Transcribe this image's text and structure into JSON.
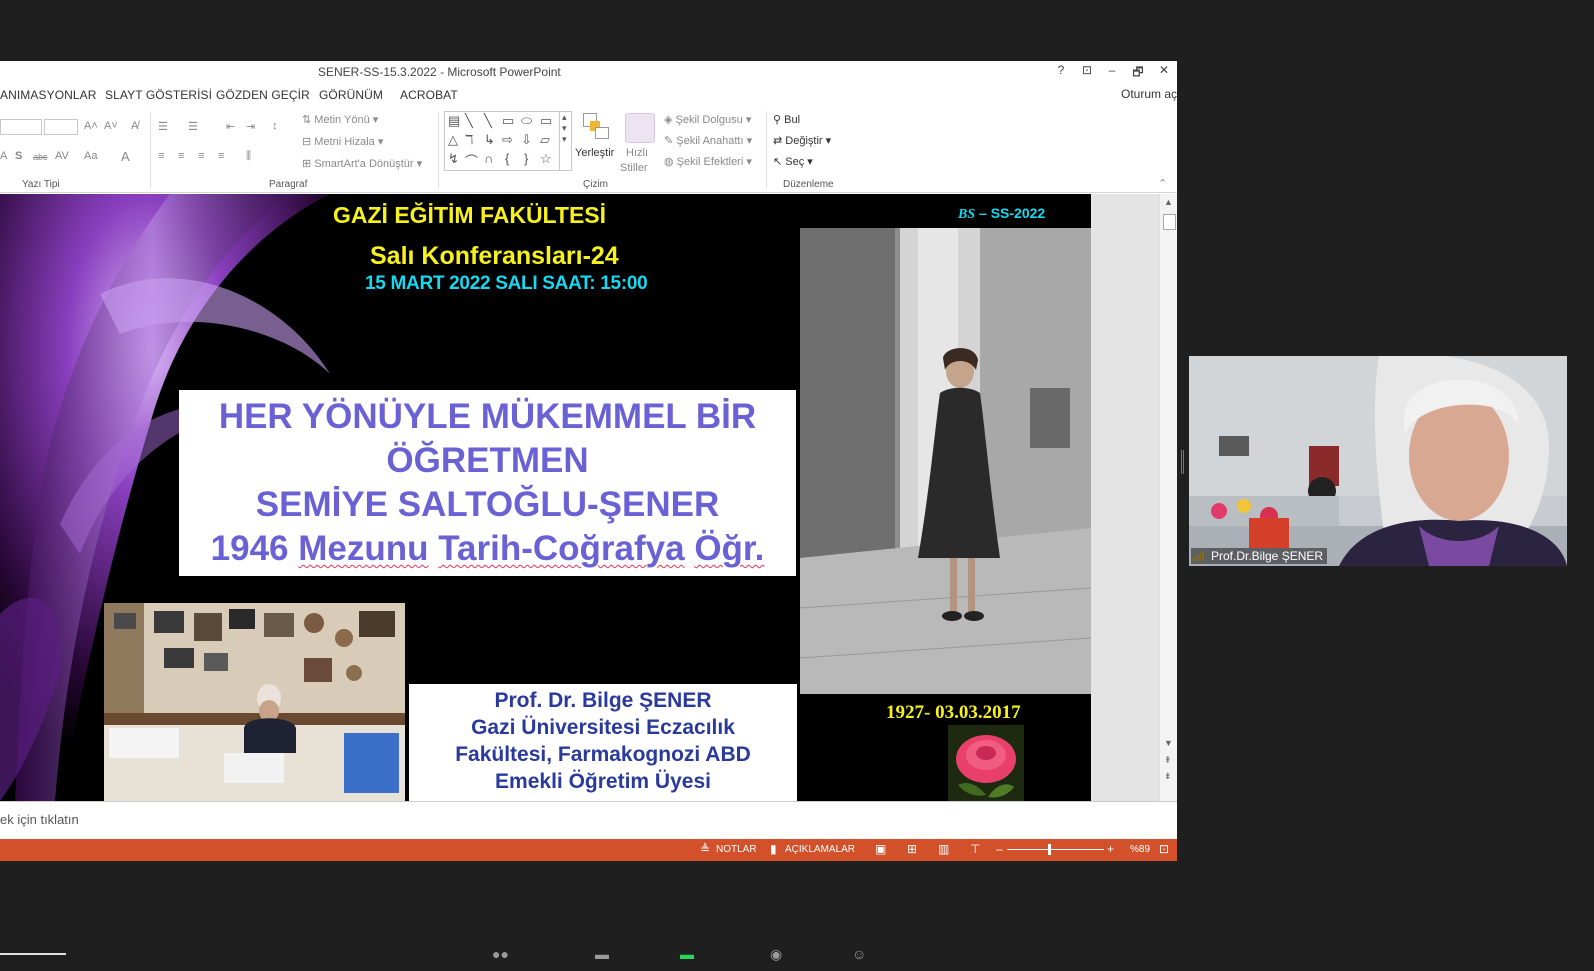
{
  "window": {
    "title": "SENER-SS-15.3.2022 - Microsoft PowerPoint",
    "help": "?",
    "minimize": "–",
    "restore": "🗗",
    "close": "✕",
    "ribbon_display": "⊡"
  },
  "tabs": [
    "ANIMASYONLAR",
    "SLAYT GÖSTERİSİ",
    "GÖZDEN GEÇİR",
    "GÖRÜNÜM",
    "ACROBAT"
  ],
  "signin": "Oturum aç",
  "ribbon": {
    "groups": {
      "font": "Yazı Tipi",
      "paragraph": "Paragraf",
      "drawing": "Çizim",
      "editing": "Düzenleme"
    },
    "paragraph": {
      "text_direction": "Metin Yönü",
      "align_text": "Metni Hizala",
      "smartart": "SmartArt'a Dönüştür"
    },
    "drawing": {
      "arrange": "Yerleştir",
      "quick_styles_1": "Hızlı",
      "quick_styles_2": "Stiller",
      "shape_fill": "Şekil Dolgusu",
      "shape_outline": "Şekil Anahattı",
      "shape_effects": "Şekil Efektleri"
    },
    "editing": {
      "find": "Bul",
      "replace": "Değiştir",
      "select": "Seç"
    }
  },
  "slide": {
    "faculty": "GAZİ EĞİTİM FAKÜLTESİ",
    "code_prefix": "BS",
    "code_suffix": " – SS-2022",
    "series": "Salı Konferansları-24",
    "date": "15 MART 2022  SALI  SAAT: 15:00",
    "main": {
      "line1": "HER YÖNÜYLE MÜKEMMEL BİR",
      "line2": "ÖĞRETMEN",
      "line3": "SEMİYE SALTOĞLU-ŞENER",
      "line4_a": "1946 ",
      "line4_b": "Mezunu",
      "line4_c": " ",
      "line4_d": "Tarih-Coğrafya",
      "line4_e": " ",
      "line4_f": "Öğr."
    },
    "presenter": {
      "line1": "Prof. Dr. Bilge ŞENER",
      "line2": "Gazi Üniversitesi Eczacılık",
      "line3": "Fakültesi, Farmakognozi ABD",
      "line4": "Emekli Öğretim Üyesi"
    },
    "years": "1927-  03.03.2017"
  },
  "notes_hint": "ek için tıklatın",
  "status": {
    "notes": "NOTLAR",
    "comments": "AÇIKLAMALAR",
    "zoom": "%89",
    "zoom_level_percent": 89
  },
  "video": {
    "participant": "Prof.Dr.Bilge ŞENER"
  },
  "colors": {
    "accent_orange": "#d2502a",
    "slide_yellow": "#f7f21b",
    "slide_cyan": "#16d8f0",
    "title_purple": "#6a62d4",
    "presenter_blue": "#2a3a9c"
  }
}
